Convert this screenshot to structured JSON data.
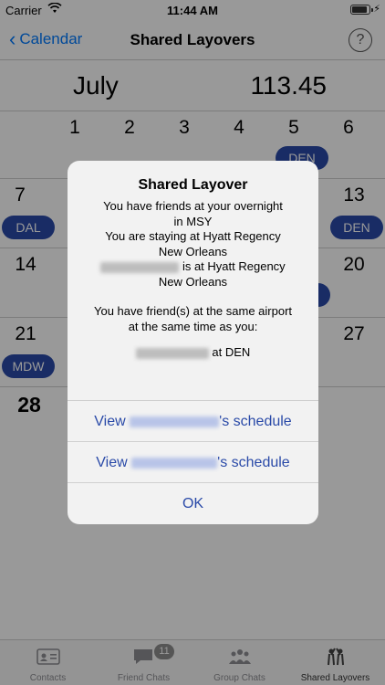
{
  "status_bar": {
    "carrier": "Carrier",
    "time": "11:44 AM"
  },
  "nav": {
    "back_label": "Calendar",
    "title": "Shared Layovers",
    "help": "?"
  },
  "calendar": {
    "month": "July",
    "hours": "113.45",
    "week1": [
      "1",
      "2",
      "3",
      "4",
      "5",
      "6"
    ],
    "week2_left": "7",
    "week2_right": "13",
    "week3_left": "14",
    "week3_right": "20",
    "week4_left": "21",
    "week4_right": "27",
    "week5_left": "28",
    "pills": {
      "w1": "DEN",
      "w2_left": "DAL",
      "w2_right": "DEN",
      "w4_left": "MDW"
    }
  },
  "alert": {
    "title": "Shared Layover",
    "line1": "You have friends at your overnight",
    "line2": "in MSY",
    "line3": "You are staying at Hyatt Regency",
    "line4": "New Orleans",
    "line5_suffix": "is at Hyatt Regency",
    "line6": "New Orleans",
    "line7": "You have friend(s) at the same airport",
    "line8": "at the same time as you:",
    "line9_suffix": "at DEN",
    "btn1_prefix": "View",
    "btn1_suffix": "'s schedule",
    "btn2_prefix": "View",
    "btn2_suffix": "'s schedule",
    "ok": "OK"
  },
  "tabs": [
    {
      "label": "Contacts"
    },
    {
      "label": "Friend Chats",
      "badge": "11"
    },
    {
      "label": "Group Chats"
    },
    {
      "label": "Shared Layovers"
    }
  ]
}
